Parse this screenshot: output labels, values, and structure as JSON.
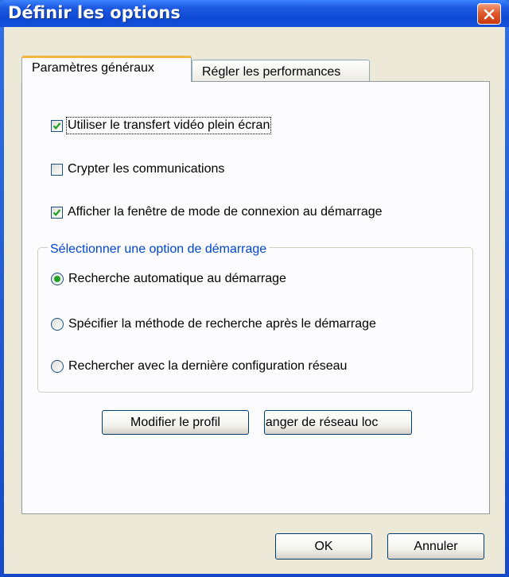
{
  "window": {
    "title": "Définir les options"
  },
  "tabs": [
    {
      "label": "Paramètres généraux",
      "active": true
    },
    {
      "label": "Régler les performances",
      "active": false
    }
  ],
  "options": {
    "fullscreen_video": {
      "label": "Utiliser le transfert vidéo plein écran",
      "checked": true
    },
    "encrypt": {
      "label": "Crypter les communications",
      "checked": false
    },
    "show_connection_mode": {
      "label": "Afficher la fenêtre de mode de connexion au démarrage",
      "checked": true
    }
  },
  "startup_group": {
    "title": "Sélectionner une option de démarrage",
    "options": [
      {
        "label": "Recherche automatique au démarrage",
        "selected": true
      },
      {
        "label": "Spécifier la méthode de recherche après le démarrage",
        "selected": false
      },
      {
        "label": "Rechercher avec la dernière configuration réseau",
        "selected": false
      }
    ]
  },
  "buttons": {
    "modify_profile": "Modifier le profil",
    "change_network": "hanger de réseau loc",
    "ok": "OK",
    "cancel": "Annuler"
  },
  "colors": {
    "titlebar": "#0f4ad5",
    "dialog_bg": "#ece9d8",
    "tab_accent": "#f5b540",
    "group_label": "#0046d5",
    "radio_dot": "#21a121",
    "check_mark": "#21a121"
  }
}
